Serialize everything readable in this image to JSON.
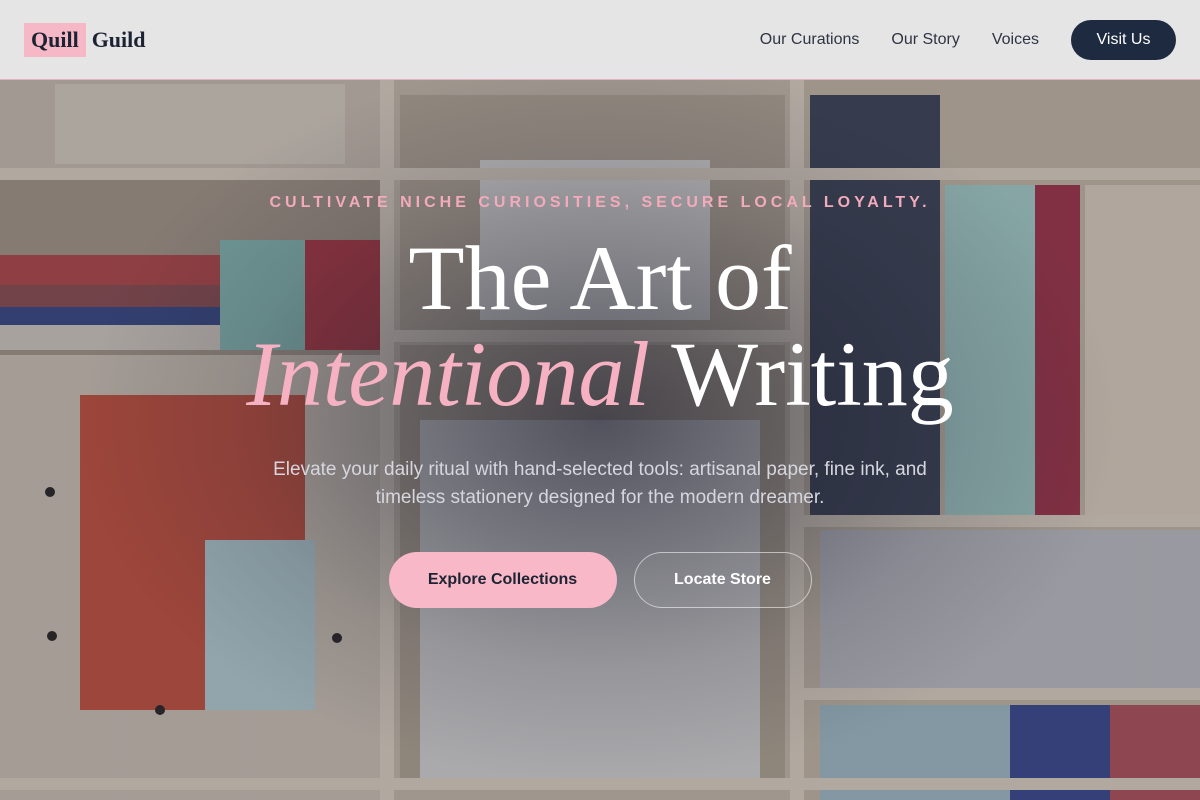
{
  "brand": {
    "mark": "Quill",
    "name": "Guild"
  },
  "nav": {
    "links": [
      "Our Curations",
      "Our Story",
      "Voices"
    ],
    "cta": "Visit Us"
  },
  "hero": {
    "eyebrow": "CULTIVATE NICHE CURIOSITIES, SECURE LOCAL LOYALTY.",
    "title_line1": "The Art of",
    "title_accent": "Intentional",
    "title_end": "Writing",
    "subtitle": "Elevate your daily ritual with hand-selected tools: artisanal paper, fine ink, and timeless stationery designed for the modern dreamer.",
    "primary_button": "Explore Collections",
    "secondary_button": "Locate Store"
  },
  "colors": {
    "accent_pink": "#f6b8c6",
    "navy": "#1e2a40",
    "overlay": "#1c1e2e"
  }
}
